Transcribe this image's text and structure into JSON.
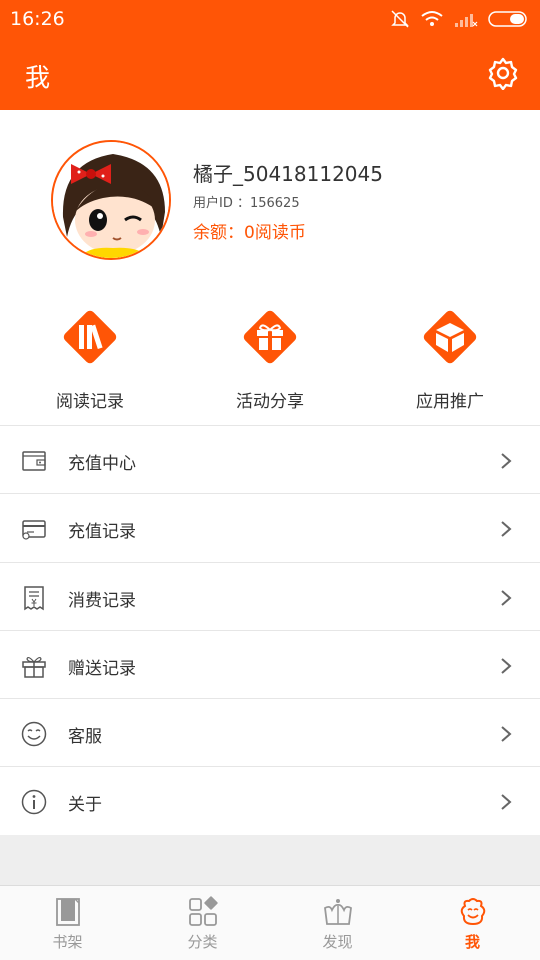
{
  "status_bar": {
    "time": "16:26"
  },
  "header": {
    "title": "我",
    "settings_icon": "gear-icon"
  },
  "profile": {
    "username": "橘子_50418112045",
    "user_id": "用户ID ：156625",
    "balance": "余额：0阅读币"
  },
  "quick_actions": [
    {
      "label": "阅读记录",
      "icon": "books-icon"
    },
    {
      "label": "活动分享",
      "icon": "gift-icon"
    },
    {
      "label": "应用推广",
      "icon": "box-icon"
    }
  ],
  "menu": [
    {
      "label": "充值中心",
      "icon": "wallet-icon"
    },
    {
      "label": "充值记录",
      "icon": "card-icon"
    },
    {
      "label": "消费记录",
      "icon": "receipt-icon"
    },
    {
      "label": "赠送记录",
      "icon": "gift-outline-icon"
    },
    {
      "label": "客服",
      "icon": "smile-icon"
    },
    {
      "label": "关于",
      "icon": "info-icon"
    }
  ],
  "bottom_nav": [
    {
      "label": "书架",
      "icon": "bookshelf-icon",
      "active": false
    },
    {
      "label": "分类",
      "icon": "category-icon",
      "active": false
    },
    {
      "label": "发现",
      "icon": "crown-icon",
      "active": false
    },
    {
      "label": "我",
      "icon": "me-icon",
      "active": true
    }
  ],
  "colors": {
    "accent": "#ff5506",
    "text": "#333333",
    "muted": "#999999",
    "divider": "#e6e6e6"
  }
}
